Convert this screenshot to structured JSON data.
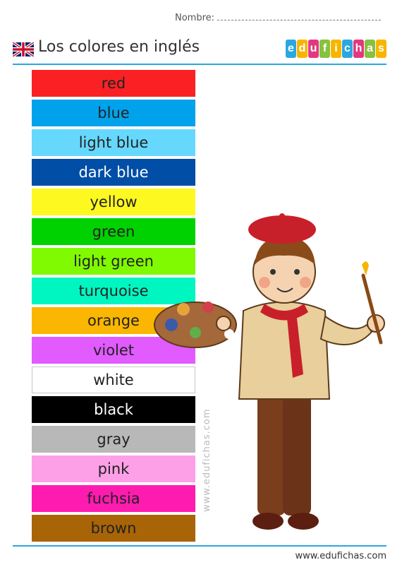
{
  "header": {
    "name_label": "Nombre:",
    "title": "Los colores en inglés",
    "logo_letters": [
      "e",
      "d",
      "u",
      "f",
      "i",
      "c",
      "h",
      "a",
      "s"
    ],
    "logo_colors": [
      "#2aa7e0",
      "#f7b500",
      "#e3387f",
      "#86c23f",
      "#f7b500",
      "#2aa7e0",
      "#e3387f",
      "#86c23f",
      "#f7b500"
    ]
  },
  "colors": [
    {
      "label": "red",
      "bg": "#fa2125",
      "fg": "#222222"
    },
    {
      "label": "blue",
      "bg": "#00a2ec",
      "fg": "#222222"
    },
    {
      "label": "light blue",
      "bg": "#66d8fd",
      "fg": "#222222"
    },
    {
      "label": "dark blue",
      "bg": "#014ea6",
      "fg": "#ffffff"
    },
    {
      "label": "yellow",
      "bg": "#fdf820",
      "fg": "#222222"
    },
    {
      "label": "green",
      "bg": "#00d100",
      "fg": "#222222"
    },
    {
      "label": "light green",
      "bg": "#80fa00",
      "fg": "#222222"
    },
    {
      "label": "turquoise",
      "bg": "#00f6c1",
      "fg": "#222222"
    },
    {
      "label": "orange",
      "bg": "#fab600",
      "fg": "#222222"
    },
    {
      "label": "violet",
      "bg": "#e15bff",
      "fg": "#222222"
    },
    {
      "label": "white",
      "bg": "#ffffff",
      "fg": "#222222",
      "border": "#c8c8c8"
    },
    {
      "label": "black",
      "bg": "#000000",
      "fg": "#ffffff"
    },
    {
      "label": "gray",
      "bg": "#b8b8b8",
      "fg": "#222222"
    },
    {
      "label": "pink",
      "bg": "#fea0e8",
      "fg": "#222222"
    },
    {
      "label": "fuchsia",
      "bg": "#fe1bb0",
      "fg": "#222222"
    },
    {
      "label": "brown",
      "bg": "#a86406",
      "fg": "#222222"
    }
  ],
  "watermark": "www.edufichas.com",
  "footer": {
    "url": "www.edufichas.com"
  },
  "accent_color": "#2aa7e0"
}
